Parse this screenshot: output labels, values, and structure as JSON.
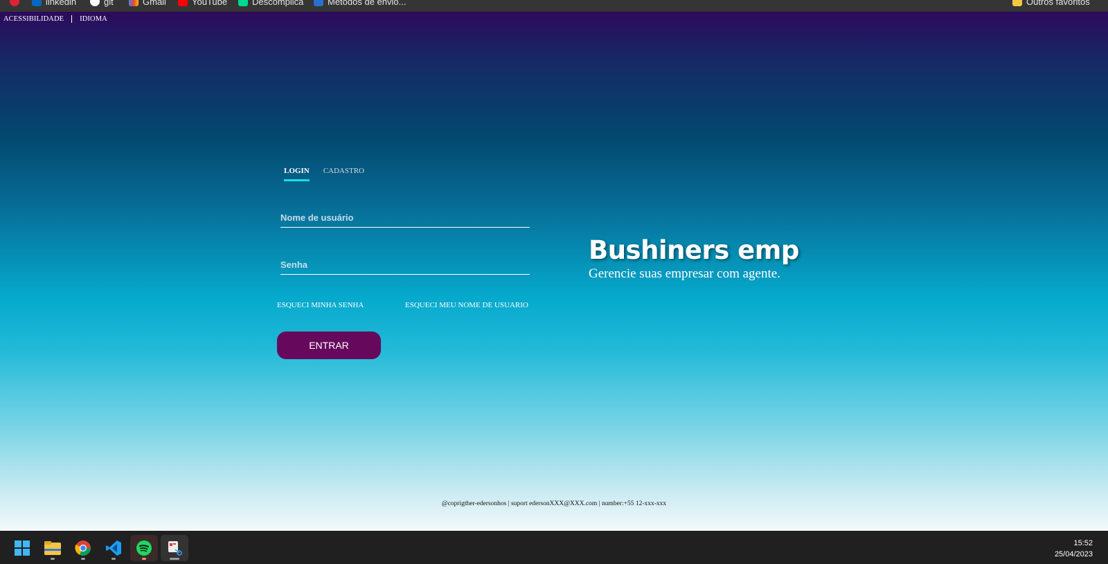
{
  "bookmarks_bar": {
    "items": [
      {
        "label": "",
        "icon": "app-icon"
      },
      {
        "label": "linkedin",
        "icon": "linkedin-icon"
      },
      {
        "label": "git",
        "icon": "github-icon"
      },
      {
        "label": "Gmail",
        "icon": "gmail-icon"
      },
      {
        "label": "YouTube",
        "icon": "youtube-icon"
      },
      {
        "label": "Descomplica",
        "icon": "descomplica-icon"
      },
      {
        "label": "Métodos de envio...",
        "icon": "bookmark-icon"
      }
    ],
    "other_favorites": "Outros favoritos"
  },
  "topnav": {
    "accessibility": "ACESSIBILIDADE",
    "language": "IDIOMA"
  },
  "tabs": {
    "login": "LOGIN",
    "register": "CADASTRO",
    "active": "login"
  },
  "form": {
    "username_placeholder": "Nome de usuário",
    "username_value": "",
    "password_placeholder": "Senha",
    "password_value": "",
    "forgot_password": "ESQUECI MINHA SENHA",
    "forgot_username": "ESQUECI MEU NOME DE USUARIO",
    "submit": "ENTRAR"
  },
  "brand": {
    "title": "Bushiners emp",
    "subtitle": "Gerencie suas empresar com agente."
  },
  "footer": {
    "text": "@coprigther-edersonhos | suport edersonXXX@XXX.com | number:+55 12-xxx-xxx"
  },
  "taskbar": {
    "apps": [
      "windows-start-icon",
      "file-explorer-icon",
      "chrome-icon",
      "vscode-icon",
      "spotify-icon",
      "snipping-tool-icon"
    ],
    "time": "15:52",
    "date": "25/04/2023"
  },
  "colors": {
    "button_bg": "#66095d",
    "tab_underline": "#12e0ee",
    "gradient_top": "#2d0a5c",
    "gradient_bottom": "#f4f9fb"
  }
}
